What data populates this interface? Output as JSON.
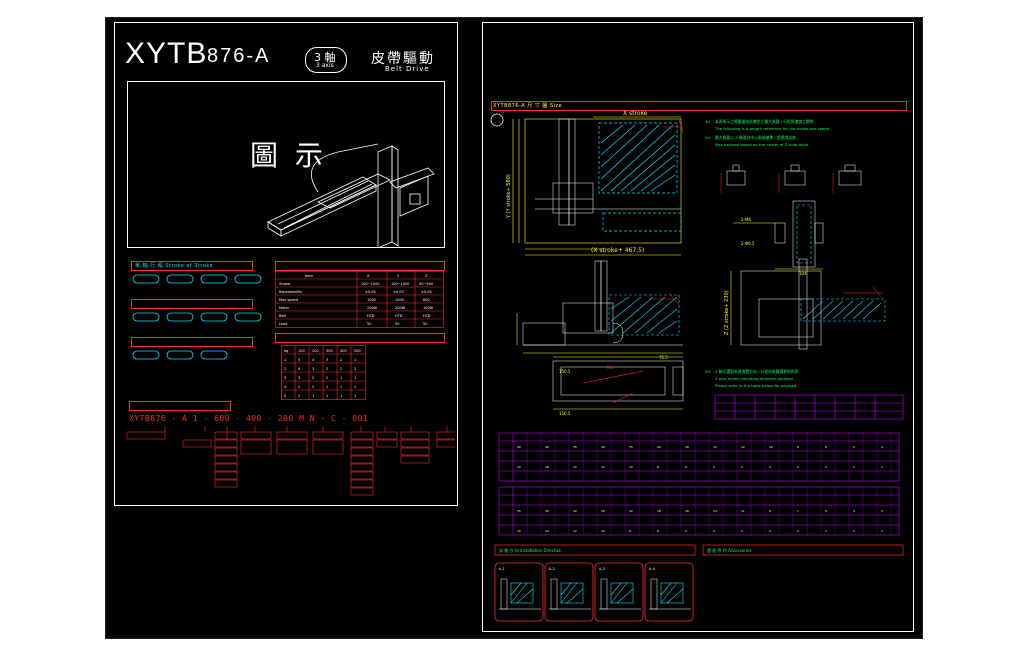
{
  "colors": {
    "background": "#000000",
    "frame": "#ffffff",
    "red": "#ff2a2a",
    "green": "#00ff66",
    "yellow": "#ffff00",
    "cyan": "#00e5ff",
    "magenta": "#c000ff",
    "page_bg": "#ffffff"
  },
  "left_sheet": {
    "model_prefix": "XYTB",
    "model_number": "876-A",
    "axis_badge_main": "3 軸",
    "axis_badge_sub": "3 axis",
    "drive_cn": "皮帶驅動",
    "drive_en": "Belt Drive",
    "figure_label": "圖 示",
    "order_code_line": "XYTB876 - A     1  -  600  -  400  -  200     M    N  -  C  -  001"
  },
  "right_sheet": {
    "note_71": "※1",
    "dim_x_stroke": "X stroke",
    "dim_bottom": "(X stroke+ 467.5)",
    "dim_left_v": "Y (Y stroke+ 580)",
    "dim_right_v": "Z (Z stroke+ 230)",
    "dim_values": [
      "10",
      "20",
      "150.5",
      "1.5",
      "104",
      "54",
      "28",
      "M6",
      "75.5",
      "M3"
    ]
  },
  "icons": {
    "figure": "xyz-gantry-icon",
    "detail": "motor-flange-icon"
  }
}
